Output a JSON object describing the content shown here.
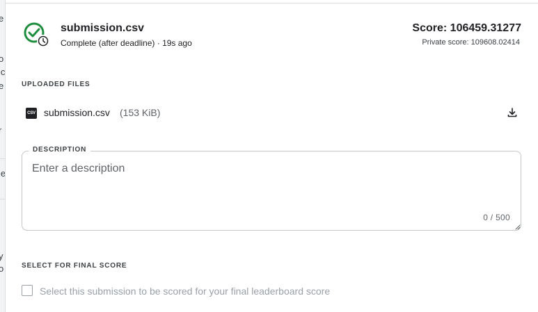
{
  "background_page": {
    "peek_letters": [
      "e",
      "o",
      "ic",
      "e",
      "r",
      "le",
      "y",
      "o"
    ]
  },
  "submission": {
    "file_name": "submission.csv",
    "status_text": "Complete (after deadline) · 19s ago",
    "score_text": "Score: 106459.31277",
    "private_score_text": "Private score: 109608.02414",
    "status_icon": "check-circle-clock-icon",
    "status_color": "#1e8e3e"
  },
  "uploaded_files": {
    "heading": "UPLOADED FILES",
    "items": [
      {
        "icon_text": "CSV",
        "name": "submission.csv",
        "size": "(153 KiB)",
        "action_icon": "download-icon"
      }
    ]
  },
  "description": {
    "legend": "DESCRIPTION",
    "placeholder": "Enter a description",
    "value": "",
    "char_count": "0 / 500"
  },
  "final_score": {
    "heading": "SELECT FOR FINAL SCORE",
    "checkbox_label": "Select this submission to be scored for your final leaderboard score",
    "checked": false
  }
}
